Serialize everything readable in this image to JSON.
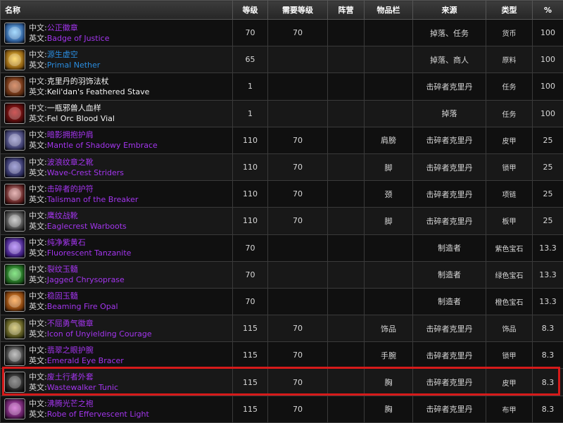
{
  "headers": {
    "name": "名称",
    "level": "等级",
    "req_level": "需要等级",
    "faction": "阵营",
    "slot": "物品栏",
    "source": "来源",
    "type": "类型",
    "percent": "%"
  },
  "labels": {
    "cn_prefix": "中文:",
    "en_prefix": "英文:"
  },
  "quality_colors": {
    "epic": "#a335ee",
    "rare": "#2a8de0",
    "common": "#f2f2f2",
    "highlight_border": "#d61a1a"
  },
  "highlighted_row": 13,
  "rows": [
    {
      "cn": "公正徽章",
      "en": "Badge of Justice",
      "quality": "epic",
      "level": "70",
      "req": "70",
      "faction": "",
      "slot": "",
      "source": "掉落、任务",
      "type": "货币",
      "pct": "100",
      "icon": "badge-icon",
      "icon_colors": [
        "#2a5a9a",
        "#8ad0ff"
      ]
    },
    {
      "cn": "源生虚空",
      "en": "Primal Nether",
      "quality": "rare",
      "level": "65",
      "req": "",
      "faction": "",
      "slot": "",
      "source": "掉落、商人",
      "type": "原料",
      "pct": "100",
      "icon": "orb-icon",
      "icon_colors": [
        "#8a5a10",
        "#ffd24a"
      ]
    },
    {
      "cn": "克里丹的羽饰法杖",
      "en": "Keli'dan's Feathered Stave",
      "quality": "common",
      "level": "1",
      "req": "",
      "faction": "",
      "slot": "",
      "source": "击碎者克里丹",
      "type": "任务",
      "pct": "100",
      "icon": "staff-icon",
      "icon_colors": [
        "#5a2a10",
        "#d07040"
      ]
    },
    {
      "cn": "一瓶邪兽人血样",
      "en": "Fel Orc Blood Vial",
      "quality": "common",
      "level": "1",
      "req": "",
      "faction": "",
      "slot": "",
      "source": "掉落",
      "type": "任务",
      "pct": "100",
      "icon": "vial-icon",
      "icon_colors": [
        "#4a0a0a",
        "#c02020"
      ]
    },
    {
      "cn": "暗影拥抱护肩",
      "en": "Mantle of Shadowy Embrace",
      "quality": "epic",
      "level": "110",
      "req": "70",
      "faction": "",
      "slot": "肩膀",
      "source": "击碎者克里丹",
      "type": "皮甲",
      "pct": "25",
      "icon": "shoulder-icon",
      "icon_colors": [
        "#3a3a6a",
        "#9a9ad0"
      ]
    },
    {
      "cn": "波浪纹章之靴",
      "en": "Wave-Crest Striders",
      "quality": "epic",
      "level": "110",
      "req": "70",
      "faction": "",
      "slot": "脚",
      "source": "击碎者克里丹",
      "type": "锁甲",
      "pct": "25",
      "icon": "boots-icon",
      "icon_colors": [
        "#2a2a5a",
        "#8a8ad0"
      ]
    },
    {
      "cn": "击碎者的护符",
      "en": "Talisman of the Breaker",
      "quality": "epic",
      "level": "110",
      "req": "70",
      "faction": "",
      "slot": "颈",
      "source": "击碎者克里丹",
      "type": "项链",
      "pct": "25",
      "icon": "eye-amulet-icon",
      "icon_colors": [
        "#5a1a1a",
        "#e0a0a0"
      ]
    },
    {
      "cn": "鹰纹战靴",
      "en": "Eaglecrest Warboots",
      "quality": "epic",
      "level": "110",
      "req": "70",
      "faction": "",
      "slot": "脚",
      "source": "击碎者克里丹",
      "type": "板甲",
      "pct": "25",
      "icon": "warboots-icon",
      "icon_colors": [
        "#3a3a3a",
        "#c0c0c0"
      ]
    },
    {
      "cn": "纯净紫黄石",
      "en": "Fluorescent Tanzanite",
      "quality": "epic",
      "level": "70",
      "req": "",
      "faction": "",
      "slot": "",
      "source": "制造者",
      "type": "紫色宝石",
      "pct": "13.3",
      "icon": "purple-gem-icon",
      "icon_colors": [
        "#3a1a7a",
        "#b080ff"
      ]
    },
    {
      "cn": "裂纹玉髓",
      "en": "Jagged Chrysoprase",
      "quality": "epic",
      "level": "70",
      "req": "",
      "faction": "",
      "slot": "",
      "source": "制造者",
      "type": "绿色宝石",
      "pct": "13.3",
      "icon": "green-gem-icon",
      "icon_colors": [
        "#1a5a1a",
        "#60e060"
      ]
    },
    {
      "cn": "稳固玉髓",
      "en": "Beaming Fire Opal",
      "quality": "epic",
      "level": "70",
      "req": "",
      "faction": "",
      "slot": "",
      "source": "制造者",
      "type": "橙色宝石",
      "pct": "13.3",
      "icon": "orange-gem-icon",
      "icon_colors": [
        "#7a3a0a",
        "#ffa040"
      ]
    },
    {
      "cn": "不屈勇气徽章",
      "en": "Icon of Unyielding Courage",
      "quality": "epic",
      "level": "115",
      "req": "70",
      "faction": "",
      "slot": "饰品",
      "source": "击碎者克里丹",
      "type": "饰品",
      "pct": "8.3",
      "icon": "banner-icon",
      "icon_colors": [
        "#4a4a1a",
        "#d0c060"
      ]
    },
    {
      "cn": "翡翠之眼护腕",
      "en": "Emerald Eye Bracer",
      "quality": "epic",
      "level": "115",
      "req": "70",
      "faction": "",
      "slot": "手腕",
      "source": "击碎者克里丹",
      "type": "锁甲",
      "pct": "8.3",
      "icon": "bracer-icon",
      "icon_colors": [
        "#2a2a2a",
        "#b0b0b0"
      ]
    },
    {
      "cn": "废土行者外套",
      "en": "Wastewalker Tunic",
      "quality": "epic",
      "level": "115",
      "req": "70",
      "faction": "",
      "slot": "胸",
      "source": "击碎者克里丹",
      "type": "皮甲",
      "pct": "8.3",
      "icon": "tunic-icon",
      "icon_colors": [
        "#1a1a1a",
        "#707070"
      ]
    },
    {
      "cn": "沸腾光芒之袍",
      "en": "Robe of Effervescent Light",
      "quality": "epic",
      "level": "115",
      "req": "70",
      "faction": "",
      "slot": "胸",
      "source": "击碎者克里丹",
      "type": "布甲",
      "pct": "8.3",
      "icon": "robe-icon",
      "icon_colors": [
        "#5a1a5a",
        "#d060d0"
      ]
    }
  ]
}
